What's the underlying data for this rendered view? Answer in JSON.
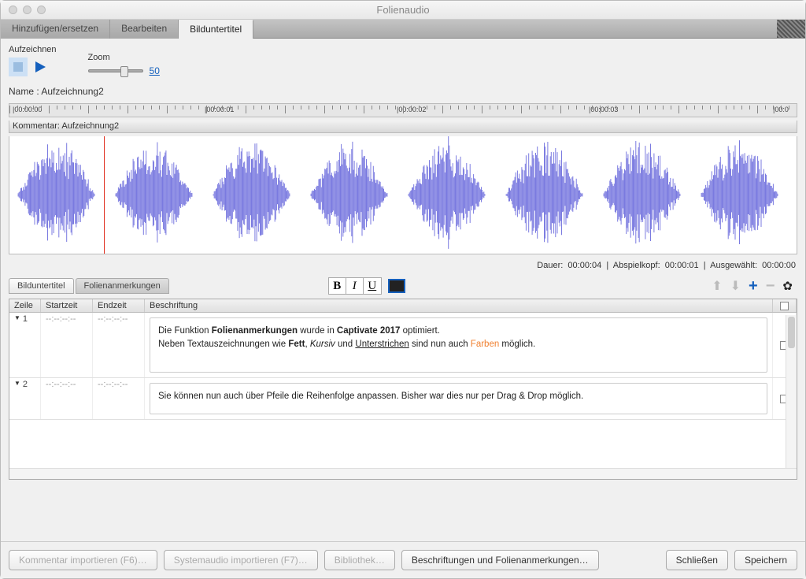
{
  "window": {
    "title": "Folienaudio"
  },
  "tabs": {
    "items": [
      "Hinzufügen/ersetzen",
      "Bearbeiten",
      "Bilduntertitel"
    ],
    "active_index": 2
  },
  "toolbar": {
    "record_label": "Aufzeichnen",
    "zoom_label": "Zoom",
    "zoom_value": "50"
  },
  "name_row": {
    "label": "Name :",
    "value": "Aufzeichnung2"
  },
  "ruler_ticks": [
    "|00:00:00",
    "|00:00:01",
    "|00:00:02",
    "|00:00:03",
    "|00:0"
  ],
  "kommentar_bar": "Kommentar: Aufzeichnung2",
  "status": {
    "dauer_label": "Dauer:",
    "dauer_value": "00:00:04",
    "abspiel_label": "Abspielkopf:",
    "abspiel_value": "00:00:01",
    "ausgewaehlt_label": "Ausgewählt:",
    "ausgewaehlt_value": "00:00:00"
  },
  "subtabs": {
    "caption": "Bilduntertitel",
    "notes": "Folienanmerkungen"
  },
  "table": {
    "headers": {
      "zeile": "Zeile",
      "start": "Startzeit",
      "end": "Endzeit",
      "beschr": "Beschriftung"
    },
    "rows": [
      {
        "num": "1",
        "start": "--:--:--:--",
        "end": "--:--:--:--",
        "note_html": "Die Funktion <b>Folienanmerkungen</b> wurde in <b>Captivate 2017</b> optimiert.<br>Neben Textauszeichnungen wie <b>Fett</b>, <i>Kursiv</i> und <u>Unterstrichen</u> sind nun auch <span class='farben'>Farben</span> möglich."
      },
      {
        "num": "2",
        "start": "--:--:--:--",
        "end": "--:--:--:--",
        "note_html": "Sie können nun auch über Pfeile die Reihenfolge anpassen. Bisher war dies nur per Drag & Drop möglich."
      }
    ]
  },
  "footer": {
    "import_comment": "Kommentar importieren (F6)…",
    "import_system": "Systemaudio importieren (F7)…",
    "library": "Bibliothek…",
    "captions_notes": "Beschriftungen und Folienanmerkungen…",
    "close": "Schließen",
    "save": "Speichern"
  }
}
